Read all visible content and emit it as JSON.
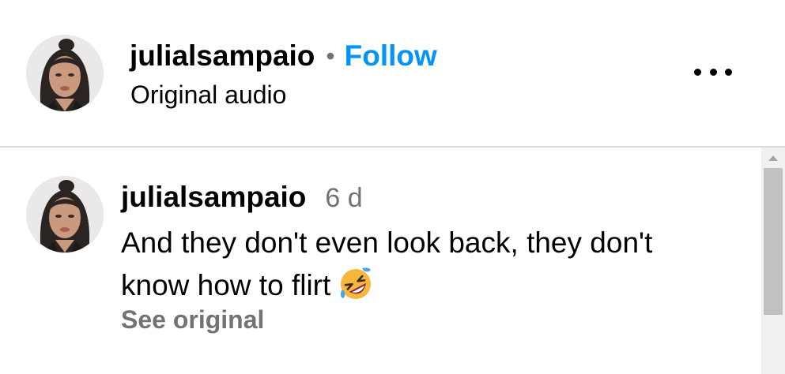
{
  "header": {
    "username": "julialsampaio",
    "separator": "•",
    "follow_label": "Follow",
    "subtitle": "Original audio",
    "avatar_icon": "profile-photo",
    "more_icon": "more-options-icon"
  },
  "comment": {
    "username": "julialsampaio",
    "time": "6 d",
    "text": "And they don't even look back, they don't know how to flirt",
    "emoji": "rolling-on-floor-laughing-emoji",
    "see_original": "See original"
  },
  "colors": {
    "link": "#0095f6",
    "muted": "#737373",
    "divider": "#dbdbdb"
  }
}
